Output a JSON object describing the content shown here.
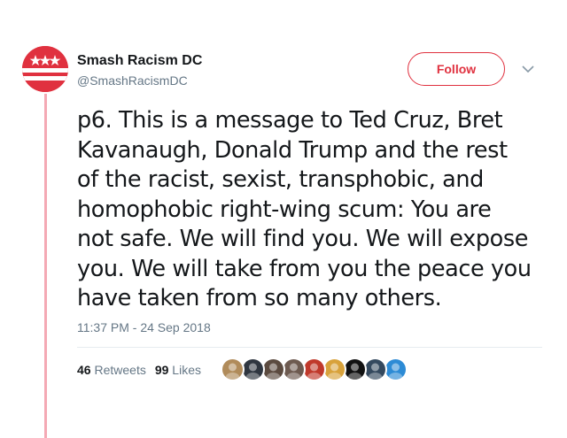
{
  "tweet": {
    "author": {
      "display_name": "Smash Racism DC",
      "handle": "@SmashRacismDC",
      "avatar_icon": "dc-flag-avatar",
      "accent_color": "#e0313f"
    },
    "follow_label": "Follow",
    "text_lines": [
      "p6. This is a message to Ted Cruz, Bret",
      "Kavanaugh, Donald Trump and the rest",
      "of the racist, sexist, transphobic, and",
      "homophobic right-wing scum: You are",
      "not safe. We will find you. We will expose",
      "you. We will take from you the peace you",
      "have taken from so many others."
    ],
    "timestamp": "11:37 PM - 24 Sep 2018",
    "retweets": {
      "count": "46",
      "label": "Retweets"
    },
    "likes": {
      "count": "99",
      "label": "Likes"
    },
    "liker_avatars": [
      {
        "icon": "liker-avatar-hat",
        "color": "#b08b5a"
      },
      {
        "icon": "liker-avatar-building",
        "color": "#2f3640"
      },
      {
        "icon": "liker-avatar-person",
        "color": "#5b4a3f"
      },
      {
        "icon": "liker-avatar-face",
        "color": "#6d5a50"
      },
      {
        "icon": "liker-avatar-figure",
        "color": "#c0392b"
      },
      {
        "icon": "liker-avatar-dog",
        "color": "#d8a23b"
      },
      {
        "icon": "liker-avatar-antifa-flag",
        "color": "#111111"
      },
      {
        "icon": "liker-avatar-dark",
        "color": "#34495e"
      },
      {
        "icon": "liker-avatar-globe",
        "color": "#2d8bd5"
      }
    ]
  }
}
